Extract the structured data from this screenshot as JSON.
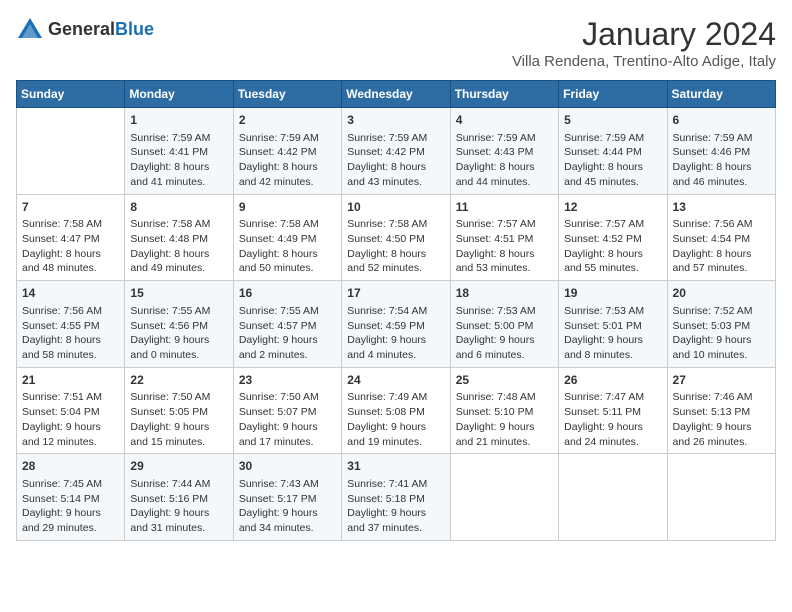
{
  "logo": {
    "text_general": "General",
    "text_blue": "Blue"
  },
  "title": "January 2024",
  "location": "Villa Rendena, Trentino-Alto Adige, Italy",
  "days_of_week": [
    "Sunday",
    "Monday",
    "Tuesday",
    "Wednesday",
    "Thursday",
    "Friday",
    "Saturday"
  ],
  "weeks": [
    [
      {
        "day": "",
        "info": ""
      },
      {
        "day": "1",
        "info": "Sunrise: 7:59 AM\nSunset: 4:41 PM\nDaylight: 8 hours\nand 41 minutes."
      },
      {
        "day": "2",
        "info": "Sunrise: 7:59 AM\nSunset: 4:42 PM\nDaylight: 8 hours\nand 42 minutes."
      },
      {
        "day": "3",
        "info": "Sunrise: 7:59 AM\nSunset: 4:42 PM\nDaylight: 8 hours\nand 43 minutes."
      },
      {
        "day": "4",
        "info": "Sunrise: 7:59 AM\nSunset: 4:43 PM\nDaylight: 8 hours\nand 44 minutes."
      },
      {
        "day": "5",
        "info": "Sunrise: 7:59 AM\nSunset: 4:44 PM\nDaylight: 8 hours\nand 45 minutes."
      },
      {
        "day": "6",
        "info": "Sunrise: 7:59 AM\nSunset: 4:46 PM\nDaylight: 8 hours\nand 46 minutes."
      }
    ],
    [
      {
        "day": "7",
        "info": "Sunrise: 7:58 AM\nSunset: 4:47 PM\nDaylight: 8 hours\nand 48 minutes."
      },
      {
        "day": "8",
        "info": "Sunrise: 7:58 AM\nSunset: 4:48 PM\nDaylight: 8 hours\nand 49 minutes."
      },
      {
        "day": "9",
        "info": "Sunrise: 7:58 AM\nSunset: 4:49 PM\nDaylight: 8 hours\nand 50 minutes."
      },
      {
        "day": "10",
        "info": "Sunrise: 7:58 AM\nSunset: 4:50 PM\nDaylight: 8 hours\nand 52 minutes."
      },
      {
        "day": "11",
        "info": "Sunrise: 7:57 AM\nSunset: 4:51 PM\nDaylight: 8 hours\nand 53 minutes."
      },
      {
        "day": "12",
        "info": "Sunrise: 7:57 AM\nSunset: 4:52 PM\nDaylight: 8 hours\nand 55 minutes."
      },
      {
        "day": "13",
        "info": "Sunrise: 7:56 AM\nSunset: 4:54 PM\nDaylight: 8 hours\nand 57 minutes."
      }
    ],
    [
      {
        "day": "14",
        "info": "Sunrise: 7:56 AM\nSunset: 4:55 PM\nDaylight: 8 hours\nand 58 minutes."
      },
      {
        "day": "15",
        "info": "Sunrise: 7:55 AM\nSunset: 4:56 PM\nDaylight: 9 hours\nand 0 minutes."
      },
      {
        "day": "16",
        "info": "Sunrise: 7:55 AM\nSunset: 4:57 PM\nDaylight: 9 hours\nand 2 minutes."
      },
      {
        "day": "17",
        "info": "Sunrise: 7:54 AM\nSunset: 4:59 PM\nDaylight: 9 hours\nand 4 minutes."
      },
      {
        "day": "18",
        "info": "Sunrise: 7:53 AM\nSunset: 5:00 PM\nDaylight: 9 hours\nand 6 minutes."
      },
      {
        "day": "19",
        "info": "Sunrise: 7:53 AM\nSunset: 5:01 PM\nDaylight: 9 hours\nand 8 minutes."
      },
      {
        "day": "20",
        "info": "Sunrise: 7:52 AM\nSunset: 5:03 PM\nDaylight: 9 hours\nand 10 minutes."
      }
    ],
    [
      {
        "day": "21",
        "info": "Sunrise: 7:51 AM\nSunset: 5:04 PM\nDaylight: 9 hours\nand 12 minutes."
      },
      {
        "day": "22",
        "info": "Sunrise: 7:50 AM\nSunset: 5:05 PM\nDaylight: 9 hours\nand 15 minutes."
      },
      {
        "day": "23",
        "info": "Sunrise: 7:50 AM\nSunset: 5:07 PM\nDaylight: 9 hours\nand 17 minutes."
      },
      {
        "day": "24",
        "info": "Sunrise: 7:49 AM\nSunset: 5:08 PM\nDaylight: 9 hours\nand 19 minutes."
      },
      {
        "day": "25",
        "info": "Sunrise: 7:48 AM\nSunset: 5:10 PM\nDaylight: 9 hours\nand 21 minutes."
      },
      {
        "day": "26",
        "info": "Sunrise: 7:47 AM\nSunset: 5:11 PM\nDaylight: 9 hours\nand 24 minutes."
      },
      {
        "day": "27",
        "info": "Sunrise: 7:46 AM\nSunset: 5:13 PM\nDaylight: 9 hours\nand 26 minutes."
      }
    ],
    [
      {
        "day": "28",
        "info": "Sunrise: 7:45 AM\nSunset: 5:14 PM\nDaylight: 9 hours\nand 29 minutes."
      },
      {
        "day": "29",
        "info": "Sunrise: 7:44 AM\nSunset: 5:16 PM\nDaylight: 9 hours\nand 31 minutes."
      },
      {
        "day": "30",
        "info": "Sunrise: 7:43 AM\nSunset: 5:17 PM\nDaylight: 9 hours\nand 34 minutes."
      },
      {
        "day": "31",
        "info": "Sunrise: 7:41 AM\nSunset: 5:18 PM\nDaylight: 9 hours\nand 37 minutes."
      },
      {
        "day": "",
        "info": ""
      },
      {
        "day": "",
        "info": ""
      },
      {
        "day": "",
        "info": ""
      }
    ]
  ]
}
